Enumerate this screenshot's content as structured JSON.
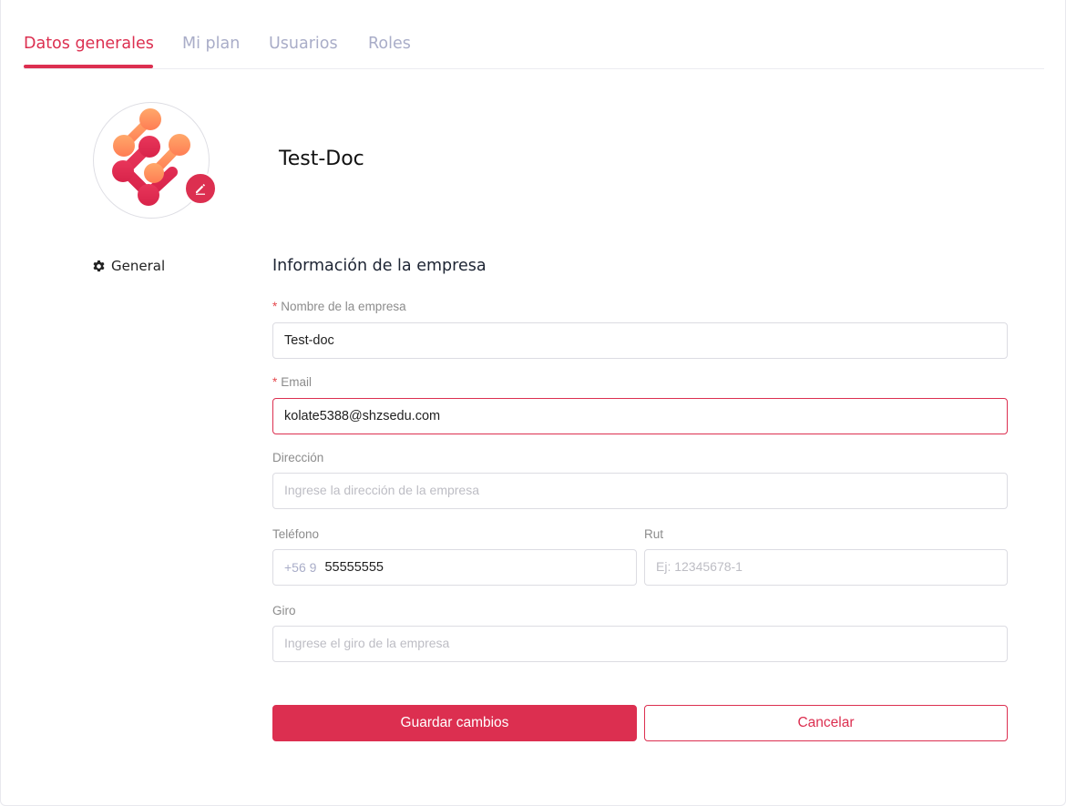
{
  "tabs": [
    {
      "label": "Datos generales",
      "active": true
    },
    {
      "label": "Mi plan",
      "active": false
    },
    {
      "label": "Usuarios",
      "active": false
    },
    {
      "label": "Roles",
      "active": false
    }
  ],
  "profile": {
    "company_name": "Test-Doc",
    "logo_icon": "molecule-logo-icon",
    "edit_icon": "pencil-icon"
  },
  "sidebar": {
    "items": [
      {
        "label": "General",
        "icon": "gear-icon"
      }
    ]
  },
  "form": {
    "title": "Información de la empresa",
    "required_mark": "*",
    "company_name": {
      "label": "Nombre de la empresa",
      "value": "Test-doc",
      "required": true
    },
    "email": {
      "label": "Email",
      "value": "kolate5388@shzsedu.com",
      "required": true
    },
    "address": {
      "label": "Dirección",
      "value": "",
      "placeholder": "Ingrese la dirección de la empresa"
    },
    "phone": {
      "label": "Teléfono",
      "prefix": "+56 9",
      "value": "55555555"
    },
    "rut": {
      "label": "Rut",
      "value": "",
      "placeholder": "Ej: 12345678-1"
    },
    "giro": {
      "label": "Giro",
      "value": "",
      "placeholder": "Ingrese el giro de la empresa"
    }
  },
  "actions": {
    "save_label": "Guardar cambios",
    "cancel_label": "Cancelar"
  },
  "colors": {
    "accent": "#dc2f50",
    "tab_inactive": "#a9adc8",
    "logo_orange": "#ff9a5a",
    "logo_red": "#e0294f"
  }
}
